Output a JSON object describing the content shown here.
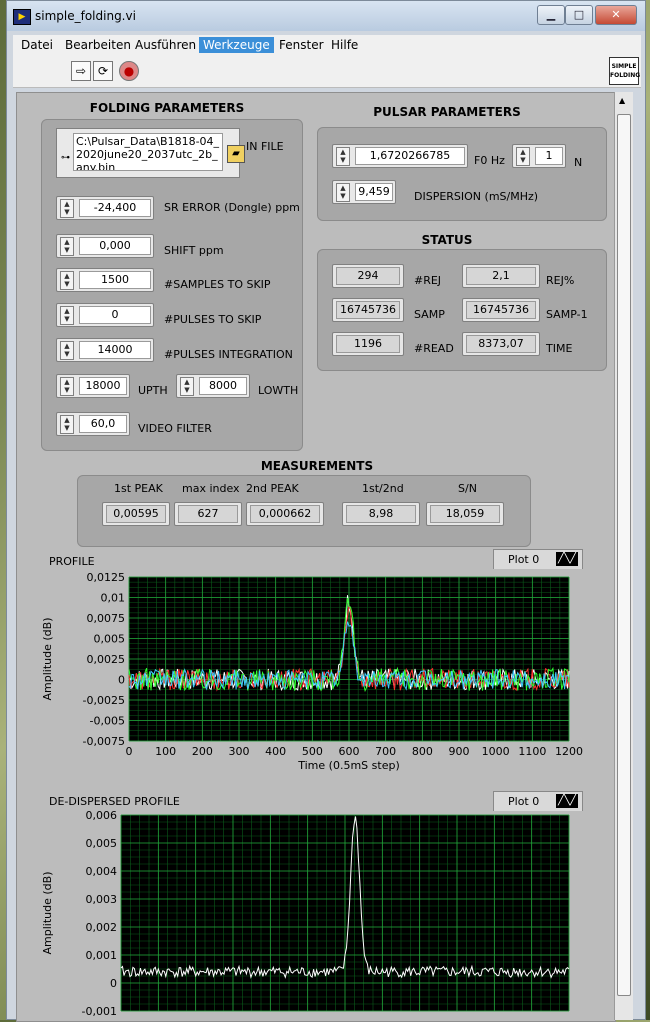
{
  "window": {
    "title": "simple_folding.vi",
    "minimize": "▁",
    "maximize": "□",
    "close": "✕",
    "app_icon": "labview-icon"
  },
  "menu": [
    "Datei",
    "Bearbeiten",
    "Ausführen",
    "Werkzeuge",
    "Fenster",
    "Hilfe"
  ],
  "menu_active": "Werkzeuge",
  "toolbar": {
    "run": "⇨",
    "run_cont": "⟳",
    "stop": "●",
    "logo_text": "SIMPLE FOLDING"
  },
  "folding": {
    "title": "FOLDING PARAMETERS",
    "in_file_path": "C:\\Pulsar_Data\\B1818-04_2020june20_2037utc_2b_any.bin",
    "in_file_label": "IN FILE",
    "sr_error": {
      "value": "-24,400",
      "label": "SR ERROR (Dongle) ppm"
    },
    "shift": {
      "value": "0,000",
      "label": "SHIFT ppm"
    },
    "samples_skip": {
      "value": "1500",
      "label": "#SAMPLES TO SKIP"
    },
    "pulses_skip": {
      "value": "0",
      "label": "#PULSES TO SKIP"
    },
    "pulses_int": {
      "value": "14000",
      "label": "#PULSES INTEGRATION"
    },
    "upth": {
      "value": "18000",
      "label": "UPTH"
    },
    "lowth": {
      "value": "8000",
      "label": "LOWTH"
    },
    "video": {
      "value": "60,0",
      "label": "VIDEO FILTER"
    }
  },
  "pulsar": {
    "title": "PULSAR PARAMETERS",
    "f0": {
      "value": "1,6720266785",
      "label": "F0 Hz"
    },
    "n": {
      "value": "1",
      "label": "N"
    },
    "dispersion": {
      "value": "9,459",
      "label": "DISPERSION (mS/MHz)"
    }
  },
  "status": {
    "title": "STATUS",
    "rej": {
      "value": "294",
      "label": "#REJ"
    },
    "rej_pct": {
      "value": "2,1",
      "label": "REJ%"
    },
    "samp": {
      "value": "16745736",
      "label": "SAMP"
    },
    "samp1": {
      "value": "16745736",
      "label": "SAMP-1"
    },
    "read": {
      "value": "1196",
      "label": "#READ"
    },
    "time": {
      "value": "8373,07",
      "label": "TIME"
    }
  },
  "measurements": {
    "title": "MEASUREMENTS",
    "items": [
      {
        "label": "1st PEAK",
        "value": "0,00595"
      },
      {
        "label": "max index",
        "value": "627"
      },
      {
        "label": "2nd PEAK",
        "value": "0,000662"
      },
      {
        "label": "1st/2nd",
        "value": "8,98"
      },
      {
        "label": "S/N",
        "value": "18,059"
      }
    ]
  },
  "chart_data": [
    {
      "type": "line",
      "title": "PROFILE",
      "legend": "Plot 0",
      "xlabel": "Time (0.5mS step)",
      "ylabel": "Amplitude (dB)",
      "xlim": [
        0,
        1200
      ],
      "ylim": [
        -0.0075,
        0.0125
      ],
      "xticks": [
        "0",
        "100",
        "200",
        "300",
        "400",
        "500",
        "600",
        "700",
        "800",
        "900",
        "1000",
        "1100",
        "1200"
      ],
      "yticks": [
        "0,0125",
        "0,01",
        "0,0075",
        "0,005",
        "0,0025",
        "0",
        "-0,0025",
        "-0,005",
        "-0,0075"
      ],
      "grid": true,
      "series": [
        {
          "color": "#ffffff",
          "peak_x": 600,
          "peak_y": 0.0098,
          "noise": 0.0022
        },
        {
          "color": "#ff3030",
          "peak_x": 600,
          "peak_y": 0.0083,
          "noise": 0.0022
        },
        {
          "color": "#30ff30",
          "peak_x": 600,
          "peak_y": 0.0091,
          "noise": 0.0023
        },
        {
          "color": "#40c8ff",
          "peak_x": 600,
          "peak_y": 0.0074,
          "noise": 0.002
        }
      ]
    },
    {
      "type": "line",
      "title": "DE-DISPERSED PROFILE",
      "legend": "Plot 0",
      "xlabel": "",
      "ylabel": "Amplitude (dB)",
      "xlim": [
        0,
        1200
      ],
      "ylim": [
        -0.0015,
        0.006
      ],
      "yticks": [
        "0,006",
        "0,005",
        "0,004",
        "0,003",
        "0,002",
        "0,001",
        "0",
        "-0,001"
      ],
      "grid": true,
      "series": [
        {
          "color": "#ffffff",
          "peak_x": 627,
          "peak_y": 0.00595,
          "noise": 0.00035
        }
      ]
    }
  ]
}
